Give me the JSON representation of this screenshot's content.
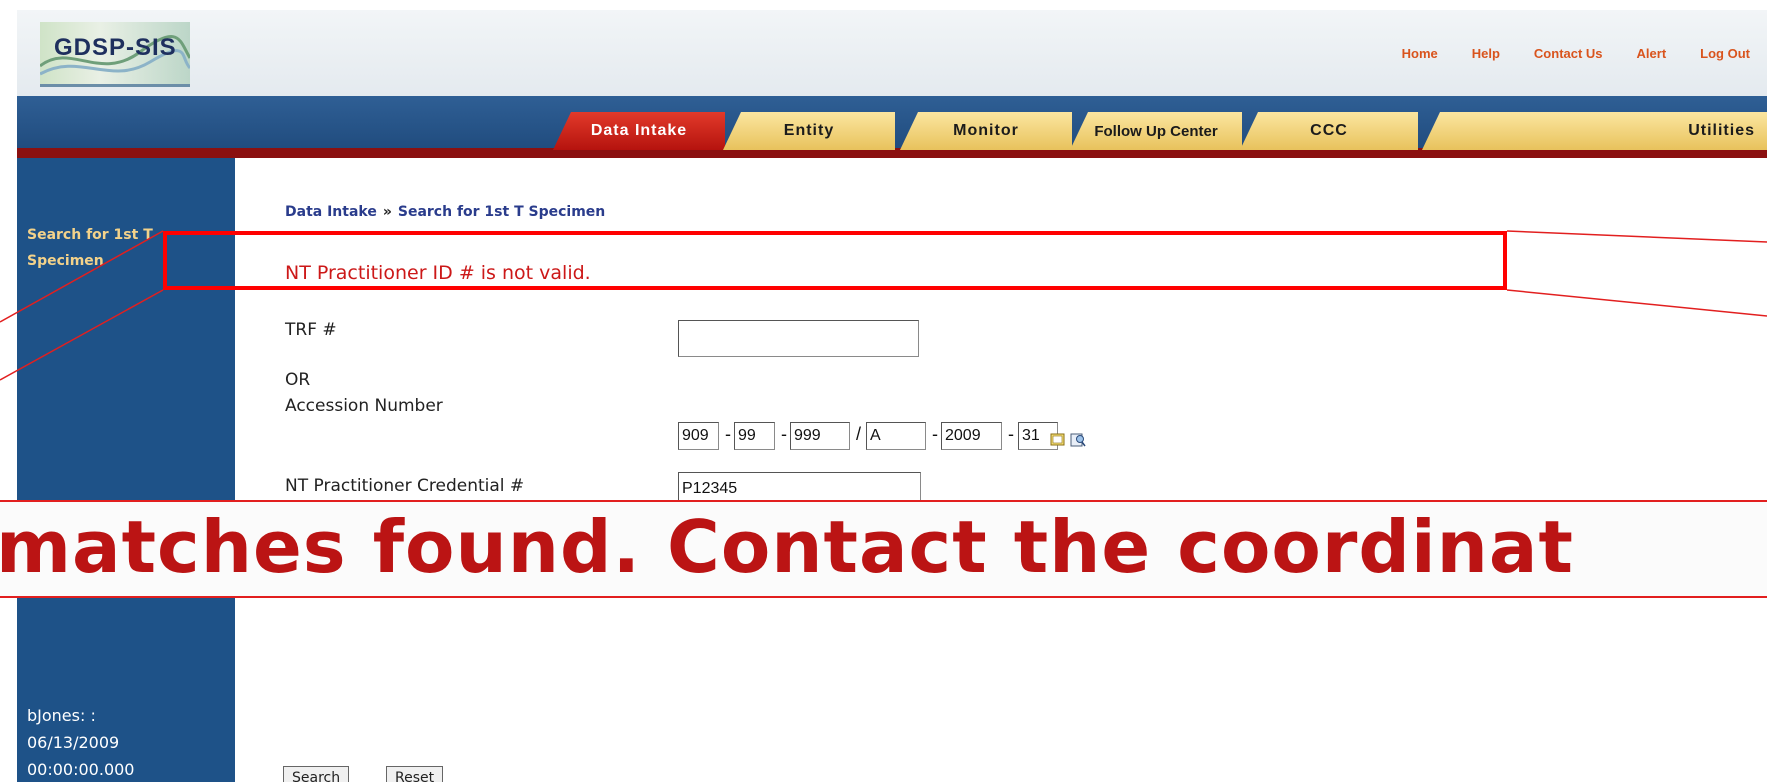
{
  "app": {
    "logo_text": "GDSP-SIS"
  },
  "top_links": [
    "Home",
    "Help",
    "Contact Us",
    "Alert",
    "Log Out"
  ],
  "tabs": {
    "data_intake": "Data Intake",
    "entity": "Entity",
    "monitor": "Monitor",
    "follow_up": "Follow Up Center",
    "ccc": "CCC",
    "utilities": "Utilities"
  },
  "sidebar": {
    "link_line1": "Search for 1st T",
    "link_line2": "Specimen",
    "user_partial": "bJones: :",
    "date": "06/13/2009",
    "time": "00:00:00.000"
  },
  "breadcrumb": {
    "root": "Data Intake",
    "separator": "»",
    "current": "Search for 1st T Specimen"
  },
  "error_message": "NT Practitioner ID # is not valid.",
  "form": {
    "trf_label": "TRF #",
    "trf_value": "",
    "or_label": "OR",
    "accession_label": "Accession Number",
    "accession_parts": [
      "909",
      "99",
      "999",
      "A",
      "2009",
      "31"
    ],
    "accession_separators": [
      "-",
      "-",
      "/",
      "-",
      "-"
    ],
    "credential_label": "NT Practitioner Credential #",
    "credential_value": "P12345",
    "search_button": "Search",
    "reset_button": "Reset"
  },
  "banner": {
    "text": "matches found. Contact the coordinat"
  },
  "colors": {
    "error_red": "#cc1818",
    "nav_blue": "#1e5288",
    "tab_gold": "#e8c25c",
    "tab_active": "#c4181a"
  }
}
